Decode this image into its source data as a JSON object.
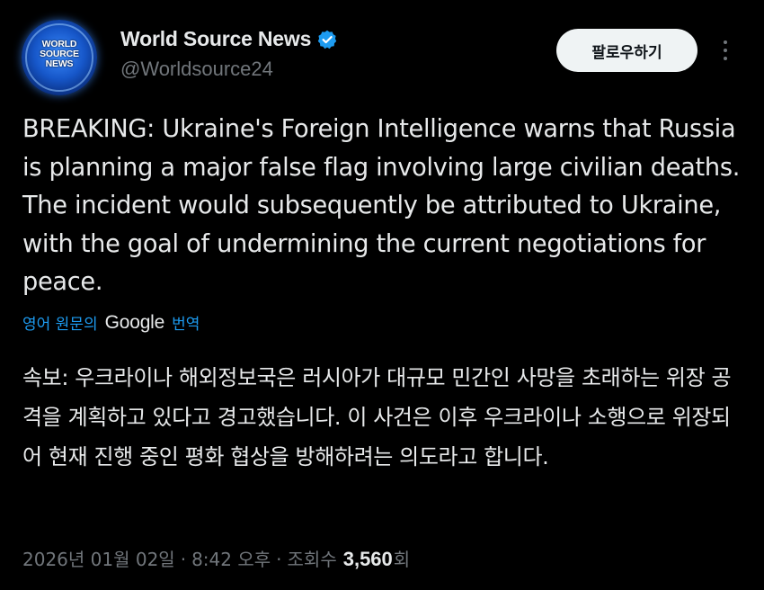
{
  "author": {
    "name": "World Source News",
    "handle": "@Worldsource24",
    "avatar_lines": [
      "WORLD",
      "SOURCE",
      "NEWS"
    ],
    "verified": true
  },
  "actions": {
    "follow_label": "팔로우하기",
    "more_icon": "more-vertical-icon"
  },
  "tweet": {
    "text": "BREAKING: Ukraine's Foreign Intelligence warns that Russia is planning a major false flag involving large civilian deaths. The incident would subsequently be attributed to Ukraine, with the goal of undermining the current negotiations for peace."
  },
  "translation": {
    "prefix": "영어 원문의",
    "provider": "Google",
    "suffix": "번역",
    "text": "속보: 우크라이나 해외정보국은 러시아가 대규모 민간인 사망을 초래하는 위장 공격을 계획하고 있다고 경고했습니다. 이 사건은 이후 우크라이나 소행으로 위장되어 현재 진행 중인 평화 협상을 방해하려는 의도라고 합니다."
  },
  "meta": {
    "date": "2026년 01월 02일",
    "time": "8:42 오후",
    "views_label": "조회수",
    "views_count": "3,560",
    "views_suffix": "회",
    "separator": "·"
  },
  "colors": {
    "background": "#000000",
    "text": "#e7e9ea",
    "muted": "#71767b",
    "link": "#1d9bf0",
    "verified_badge": "#1d9bf0"
  }
}
